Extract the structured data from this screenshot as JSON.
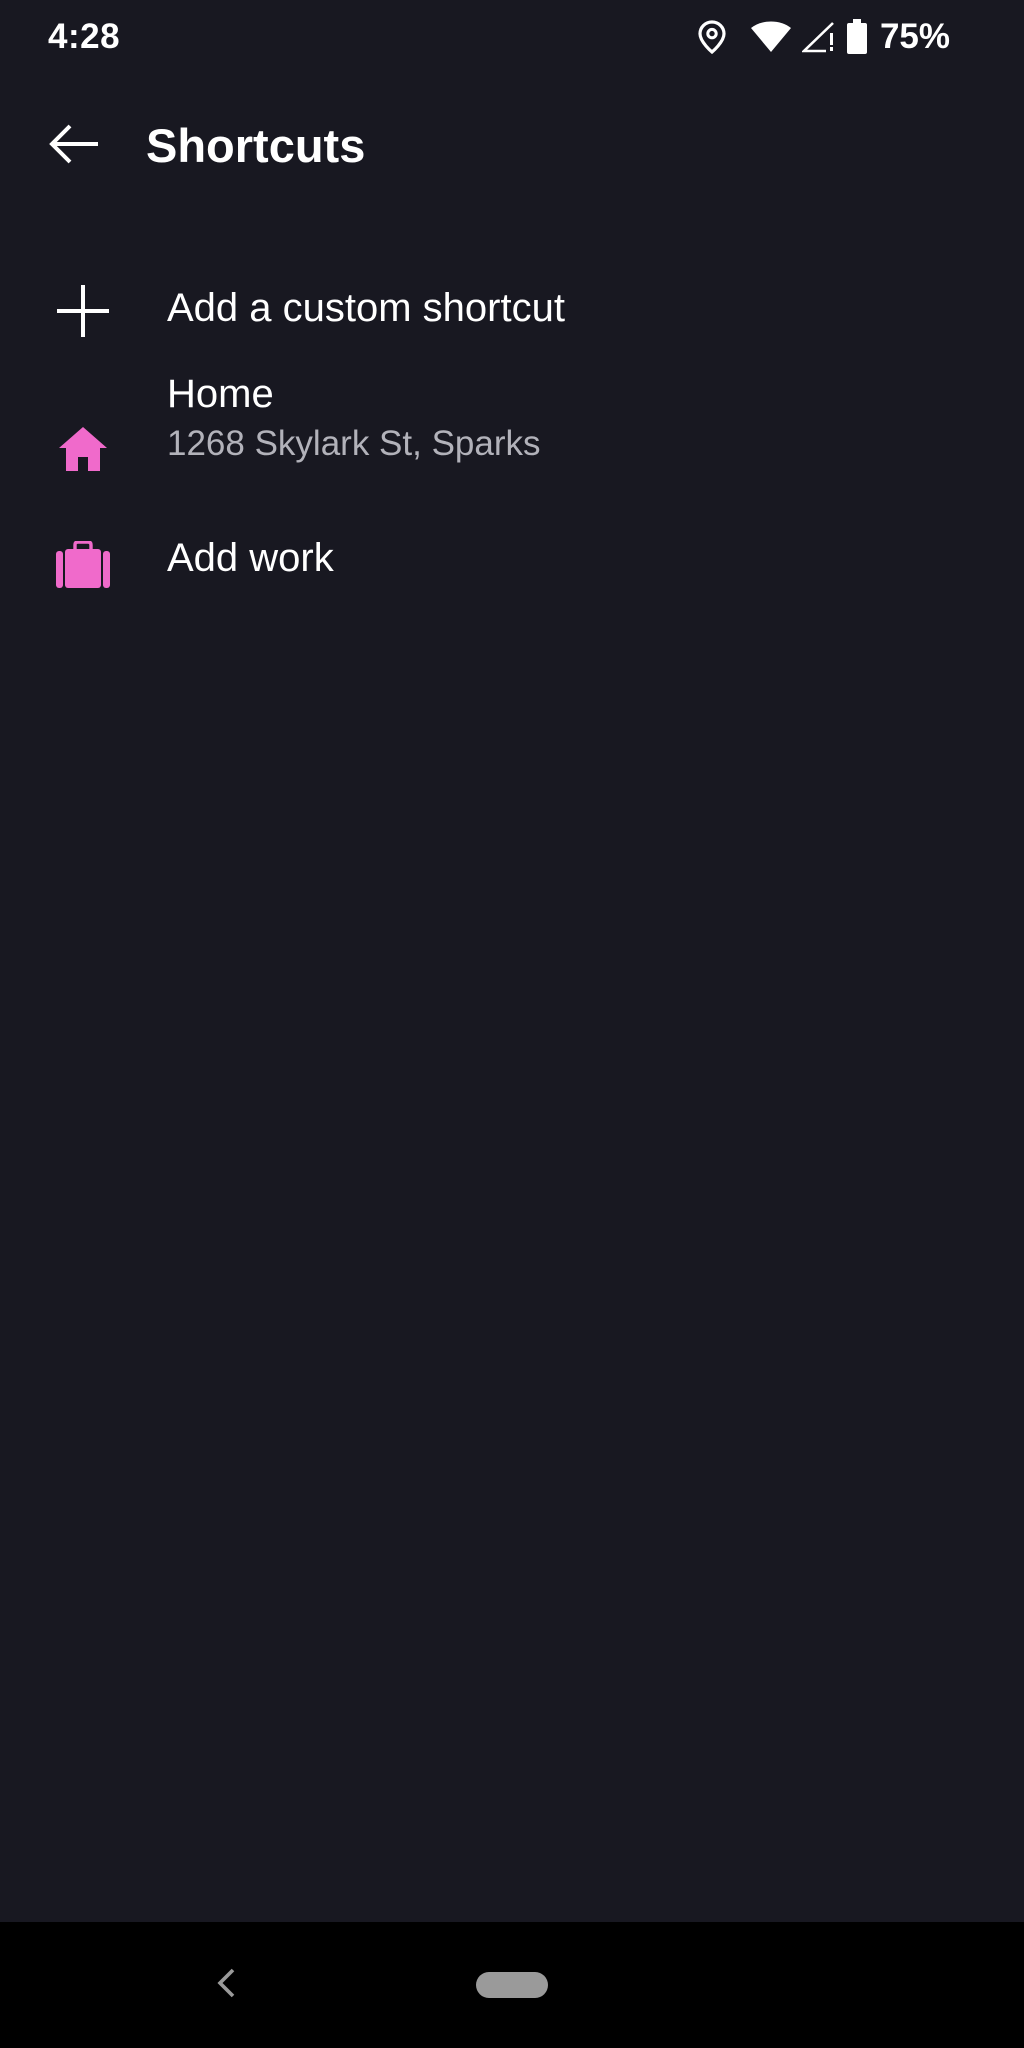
{
  "status_bar": {
    "time": "4:28",
    "battery_percent": "75%",
    "icons": [
      "location-pin-icon",
      "wifi-icon",
      "cell-signal-icon",
      "battery-icon"
    ]
  },
  "app_bar": {
    "title": "Shortcuts",
    "back_icon": "arrow-back-icon"
  },
  "shortcuts": {
    "add_custom": {
      "label": "Add a custom shortcut",
      "icon": "plus-icon"
    },
    "home": {
      "label": "Home",
      "address": "1268 Skylark St, Sparks",
      "icon": "home-icon"
    },
    "work": {
      "label": "Add work",
      "icon": "briefcase-icon"
    }
  },
  "navigation_bar": {
    "back_icon": "chevron-left-icon",
    "home_icon": "home-pill-icon"
  },
  "colors": {
    "background": "#181821",
    "accent": "#F06ACB",
    "text_primary": "#FFFFFF",
    "text_secondary": "#B2B2BA",
    "nav_bar": "#000000"
  }
}
